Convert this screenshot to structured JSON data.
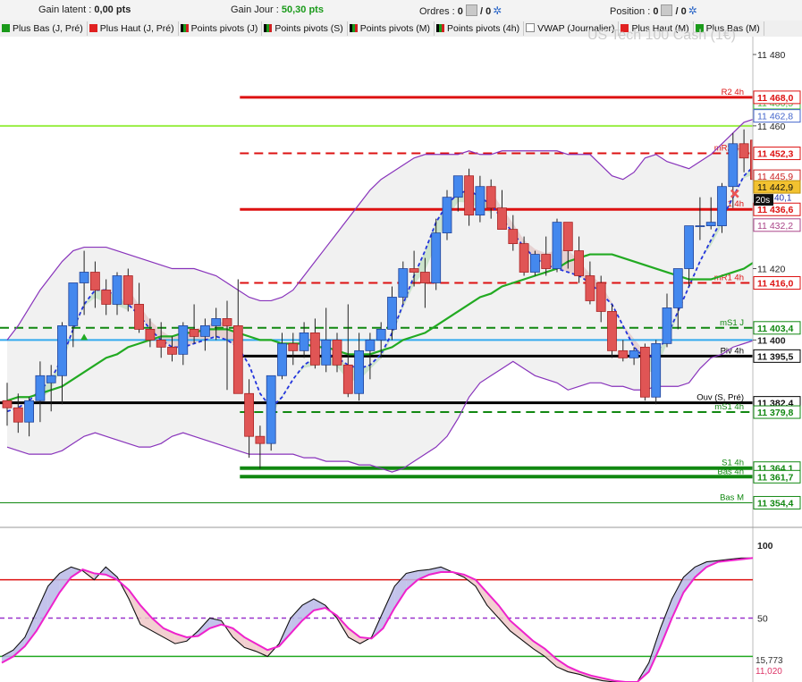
{
  "header": {
    "gain_latent_label": "Gain latent :",
    "gain_latent_value": "0,00 pts",
    "gain_jour_label": "Gain Jour :",
    "gain_jour_value": "50,30 pts",
    "ordres_label": "Ordres :",
    "ordres_count": "0",
    "ordres_sep": "/ 0",
    "position_label": "Position :",
    "position_count": "0",
    "position_sep": "/ 0"
  },
  "legend": [
    {
      "label": "Plus Bas (J, Pré)",
      "color": "#1a9a1a",
      "icon": "square-swatch"
    },
    {
      "label": "Plus Haut (J, Pré)",
      "color": "#e02020",
      "icon": "square-swatch"
    },
    {
      "label": "Points pivots (J)",
      "color": "#8b0000",
      "icon": "pivot-swatch"
    },
    {
      "label": "Points pivots (S)",
      "color": "#8b0000",
      "icon": "pivot-swatch"
    },
    {
      "label": "Points pivots (M)",
      "color": "#8b0000",
      "icon": "pivot-swatch"
    },
    {
      "label": "Points pivots (4h)",
      "color": "#8b0000",
      "icon": "pivot-swatch"
    },
    {
      "label": "VWAP (Journalier)",
      "color": "#ffffff",
      "icon": "empty-swatch"
    },
    {
      "label": "Plus Haut (M)",
      "color": "#e02020",
      "icon": "square-swatch"
    },
    {
      "label": "Plus Bas (M)",
      "color": "#1a9a1a",
      "icon": "square-swatch"
    }
  ],
  "chart_data": {
    "type": "candlestick",
    "watermark": "US Tech 100 Cash (1€)",
    "price_axis": {
      "ylim": [
        11348,
        11485
      ],
      "ticks": [
        "11 480",
        "11 460",
        "11 420",
        "11 400"
      ]
    },
    "candles": [
      {
        "o": 11383,
        "h": 11388,
        "l": 11376,
        "c": 11381
      },
      {
        "o": 11381,
        "h": 11385,
        "l": 11374,
        "c": 11377
      },
      {
        "o": 11377,
        "h": 11384,
        "l": 11373,
        "c": 11383
      },
      {
        "o": 11383,
        "h": 11394,
        "l": 11377,
        "c": 11390
      },
      {
        "o": 11388,
        "h": 11393,
        "l": 11380,
        "c": 11390
      },
      {
        "o": 11390,
        "h": 11405,
        "l": 11382,
        "c": 11404
      },
      {
        "o": 11404,
        "h": 11416,
        "l": 11398,
        "c": 11416
      },
      {
        "o": 11416,
        "h": 11425,
        "l": 11407,
        "c": 11419
      },
      {
        "o": 11419,
        "h": 11422,
        "l": 11409,
        "c": 11414
      },
      {
        "o": 11414,
        "h": 11417,
        "l": 11407,
        "c": 11410
      },
      {
        "o": 11410,
        "h": 11419,
        "l": 11407,
        "c": 11418
      },
      {
        "o": 11418,
        "h": 11420,
        "l": 11408,
        "c": 11410
      },
      {
        "o": 11410,
        "h": 11416,
        "l": 11402,
        "c": 11403
      },
      {
        "o": 11403,
        "h": 11406,
        "l": 11398,
        "c": 11400
      },
      {
        "o": 11400,
        "h": 11405,
        "l": 11395,
        "c": 11398
      },
      {
        "o": 11398,
        "h": 11401,
        "l": 11394,
        "c": 11396
      },
      {
        "o": 11396,
        "h": 11405,
        "l": 11393,
        "c": 11404
      },
      {
        "o": 11403,
        "h": 11410,
        "l": 11399,
        "c": 11401
      },
      {
        "o": 11401,
        "h": 11406,
        "l": 11397,
        "c": 11404
      },
      {
        "o": 11404,
        "h": 11409,
        "l": 11400,
        "c": 11406
      },
      {
        "o": 11406,
        "h": 11411,
        "l": 11386,
        "c": 11404
      },
      {
        "o": 11404,
        "h": 11417,
        "l": 11386,
        "c": 11385
      },
      {
        "o": 11385,
        "h": 11389,
        "l": 11367,
        "c": 11373
      },
      {
        "o": 11373,
        "h": 11376,
        "l": 11364,
        "c": 11371
      },
      {
        "o": 11371,
        "h": 11390,
        "l": 11369,
        "c": 11390
      },
      {
        "o": 11390,
        "h": 11402,
        "l": 11389,
        "c": 11399
      },
      {
        "o": 11399,
        "h": 11402,
        "l": 11393,
        "c": 11397
      },
      {
        "o": 11397,
        "h": 11405,
        "l": 11395,
        "c": 11402
      },
      {
        "o": 11402,
        "h": 11406,
        "l": 11392,
        "c": 11393
      },
      {
        "o": 11393,
        "h": 11409,
        "l": 11391,
        "c": 11400
      },
      {
        "o": 11400,
        "h": 11402,
        "l": 11391,
        "c": 11393
      },
      {
        "o": 11393,
        "h": 11410,
        "l": 11384,
        "c": 11385
      },
      {
        "o": 11385,
        "h": 11402,
        "l": 11383,
        "c": 11397
      },
      {
        "o": 11397,
        "h": 11402,
        "l": 11389,
        "c": 11400
      },
      {
        "o": 11400,
        "h": 11405,
        "l": 11395,
        "c": 11403
      },
      {
        "o": 11403,
        "h": 11415,
        "l": 11400,
        "c": 11412
      },
      {
        "o": 11412,
        "h": 11422,
        "l": 11410,
        "c": 11420
      },
      {
        "o": 11420,
        "h": 11425,
        "l": 11415,
        "c": 11419
      },
      {
        "o": 11419,
        "h": 11423,
        "l": 11409,
        "c": 11416
      },
      {
        "o": 11416,
        "h": 11434,
        "l": 11414,
        "c": 11430
      },
      {
        "o": 11430,
        "h": 11442,
        "l": 11428,
        "c": 11440
      },
      {
        "o": 11440,
        "h": 11446,
        "l": 11436,
        "c": 11446
      },
      {
        "o": 11446,
        "h": 11448,
        "l": 11432,
        "c": 11435
      },
      {
        "o": 11435,
        "h": 11446,
        "l": 11433,
        "c": 11443
      },
      {
        "o": 11443,
        "h": 11445,
        "l": 11434,
        "c": 11437
      },
      {
        "o": 11437,
        "h": 11442,
        "l": 11431,
        "c": 11431
      },
      {
        "o": 11431,
        "h": 11435,
        "l": 11425,
        "c": 11427
      },
      {
        "o": 11427,
        "h": 11429,
        "l": 11418,
        "c": 11419
      },
      {
        "o": 11419,
        "h": 11425,
        "l": 11418,
        "c": 11424
      },
      {
        "o": 11424,
        "h": 11429,
        "l": 11418,
        "c": 11420
      },
      {
        "o": 11420,
        "h": 11434,
        "l": 11419,
        "c": 11433
      },
      {
        "o": 11433,
        "h": 11433,
        "l": 11420,
        "c": 11425
      },
      {
        "o": 11425,
        "h": 11429,
        "l": 11416,
        "c": 11418
      },
      {
        "o": 11418,
        "h": 11422,
        "l": 11410,
        "c": 11411
      },
      {
        "o": 11416,
        "h": 11418,
        "l": 11405,
        "c": 11408
      },
      {
        "o": 11408,
        "h": 11410,
        "l": 11395,
        "c": 11397
      },
      {
        "o": 11397,
        "h": 11400,
        "l": 11394,
        "c": 11395
      },
      {
        "o": 11395,
        "h": 11398,
        "l": 11393,
        "c": 11397
      },
      {
        "o": 11398,
        "h": 11399,
        "l": 11383,
        "c": 11384
      },
      {
        "o": 11384,
        "h": 11400,
        "l": 11382,
        "c": 11399
      },
      {
        "o": 11399,
        "h": 11413,
        "l": 11398,
        "c": 11409
      },
      {
        "o": 11409,
        "h": 11420,
        "l": 11403,
        "c": 11420
      },
      {
        "o": 11420,
        "h": 11432,
        "l": 11415,
        "c": 11432
      },
      {
        "o": 11432,
        "h": 11440,
        "l": 11428,
        "c": 11432
      },
      {
        "o": 11432,
        "h": 11440,
        "l": 11431,
        "c": 11433
      },
      {
        "o": 11432,
        "h": 11444,
        "l": 11430,
        "c": 11443
      },
      {
        "o": 11443,
        "h": 11458,
        "l": 11437,
        "c": 11455
      },
      {
        "o": 11455,
        "h": 11459,
        "l": 11447,
        "c": 11451
      },
      {
        "o": 11456,
        "h": 11460,
        "l": 11444,
        "c": 11445
      }
    ],
    "series": [
      {
        "name": "MA",
        "color": "#22aa22",
        "values": [
          11383,
          11384,
          11384,
          11385,
          11386,
          11387,
          11389,
          11391,
          11393,
          11395,
          11396,
          11398,
          11399,
          11400,
          11401,
          11401,
          11402,
          11402,
          11403,
          11403,
          11403,
          11402,
          11401,
          11400,
          11400,
          11399,
          11399,
          11399,
          11398,
          11398,
          11397,
          11396,
          11396,
          11396,
          11397,
          11398,
          11400,
          11401,
          11402,
          11404,
          11406,
          11408,
          11410,
          11412,
          11413,
          11415,
          11416,
          11417,
          11418,
          11419,
          11420,
          11422,
          11423,
          11424,
          11424,
          11424,
          11423,
          11422,
          11421,
          11420,
          11419,
          11418,
          11417,
          11417,
          11417,
          11418,
          11419,
          11420,
          11422
        ]
      },
      {
        "name": "Moyenne pointillée",
        "color": "#2233dd",
        "values": [
          11380,
          11381,
          11383,
          11386,
          11389,
          11395,
          11403,
          11410,
          11414,
          11414,
          11412,
          11410,
          11407,
          11403,
          11400,
          11398,
          11398,
          11399,
          11400,
          11401,
          11400,
          11398,
          11393,
          11385,
          11381,
          11384,
          11389,
          11393,
          11395,
          11396,
          11395,
          11393,
          11392,
          11393,
          11396,
          11402,
          11410,
          11418,
          11425,
          11433,
          11438,
          11441,
          11442,
          11440,
          11438,
          11434,
          11430,
          11426,
          11423,
          11421,
          11420,
          11419,
          11418,
          11416,
          11413,
          11410,
          11404,
          11398,
          11395,
          11396,
          11401,
          11408,
          11415,
          11422,
          11428,
          11434,
          11440,
          11446,
          11449
        ]
      },
      {
        "name": "Bande supérieure",
        "color": "#8833bb",
        "values": [
          11400,
          11404,
          11409,
          11414,
          11418,
          11422,
          11425,
          11426,
          11426,
          11426,
          11425,
          11424,
          11423,
          11422,
          11421,
          11420,
          11420,
          11420,
          11419,
          11418,
          11416,
          11414,
          11412,
          11411,
          11411,
          11412,
          11414,
          11418,
          11422,
          11426,
          11430,
          11434,
          11438,
          11442,
          11445,
          11447,
          11449,
          11451,
          11452,
          11452,
          11452,
          11452,
          11453,
          11452,
          11452,
          11453,
          11453,
          11453,
          11453,
          11453,
          11453,
          11452,
          11452,
          11452,
          11449,
          11446,
          11445,
          11447,
          11451,
          11452,
          11450,
          11449,
          11448,
          11450,
          11452,
          11455,
          11458,
          11461,
          11462
        ]
      },
      {
        "name": "Bande inférieure",
        "color": "#8833bb",
        "values": [
          11370,
          11369,
          11368,
          11368,
          11368,
          11369,
          11371,
          11373,
          11374,
          11373,
          11372,
          11371,
          11370,
          11370,
          11371,
          11373,
          11374,
          11373,
          11372,
          11371,
          11370,
          11369,
          11368,
          11368,
          11368,
          11368,
          11368,
          11367,
          11367,
          11366,
          11366,
          11366,
          11365,
          11365,
          11364,
          11363,
          11364,
          11366,
          11368,
          11370,
          11373,
          11378,
          11384,
          11388,
          11390,
          11392,
          11394,
          11392,
          11390,
          11389,
          11388,
          11386,
          11387,
          11388,
          11388,
          11387,
          11387,
          11386,
          11386,
          11387,
          11387,
          11387,
          11388,
          11392,
          11395,
          11396,
          11398,
          11399,
          11400
        ]
      }
    ],
    "levels": [
      {
        "price": 11468.0,
        "label": "11 468,0",
        "name": "R2 4h",
        "color": "#dd1111",
        "style": "solid",
        "width": 3
      },
      {
        "price": 11452.3,
        "label": "11 452,3",
        "name": "mR2 4h",
        "color": "#dd1111",
        "style": "dashed",
        "width": 2
      },
      {
        "price": 11436.6,
        "label": "11 436,6",
        "name": "R1 4h",
        "color": "#dd1111",
        "style": "solid",
        "width": 3
      },
      {
        "price": 11416.0,
        "label": "11 416,0",
        "name": "mR1 4h",
        "color": "#dd1111",
        "style": "dashed",
        "width": 2
      },
      {
        "price": 11403.4,
        "label": "11 403,4",
        "name": "mS1 J",
        "color": "#118811",
        "style": "dashed",
        "width": 2
      },
      {
        "price": 11395.5,
        "label": "11 395,5",
        "name": "Piv 4h",
        "color": "#000000",
        "style": "solid",
        "width": 3
      },
      {
        "price": 11382.4,
        "label": "11 382,4",
        "name": "Ouv (S, Pré)",
        "color": "#000000",
        "style": "solid",
        "width": 3
      },
      {
        "price": 11379.8,
        "label": "11 379,8",
        "name": "mS1 4h",
        "color": "#118811",
        "style": "dashed",
        "width": 2
      },
      {
        "price": 11364.1,
        "label": "11 364,1",
        "name": "S1 4h",
        "color": "#118811",
        "style": "solid",
        "width": 4
      },
      {
        "price": 11361.7,
        "label": "11 361,7",
        "name": "Bas 4h",
        "color": "#118811",
        "style": "solid",
        "width": 4
      },
      {
        "price": 11354.4,
        "label": "11 354,4",
        "name": "Bas M",
        "color": "#118811",
        "style": "solid",
        "width": 1
      }
    ],
    "extra_lines": [
      {
        "price": 11460.0,
        "color": "#99ee44",
        "name": "Plus Haut (J, Pré)"
      },
      {
        "price": 11400.0,
        "color": "#33aaee",
        "name": "VWAP"
      }
    ],
    "price_tags": [
      {
        "price": 11466.5,
        "label": "11 466,5",
        "color": "#44bb44"
      },
      {
        "price": 11462.8,
        "label": "11 462,8",
        "color": "#4466cc"
      },
      {
        "price": 11445.9,
        "label": "11 445,9",
        "color": "#cc2222"
      },
      {
        "price": 11440.1,
        "label": "40,1",
        "color": "#2233aa"
      },
      {
        "price": 11432.2,
        "label": "11 432,2",
        "color": "#aa4488"
      }
    ],
    "current_price": {
      "price": 11442.9,
      "label": "11 442,9",
      "timer": "20s"
    },
    "oscillator": {
      "ylim": [
        0,
        100
      ],
      "levels": [
        80,
        50,
        20
      ],
      "tick_labels": [
        "100",
        "50"
      ],
      "k_values": [
        20,
        25,
        35,
        55,
        75,
        85,
        90,
        87,
        80,
        90,
        82,
        65,
        45,
        40,
        35,
        30,
        32,
        40,
        50,
        48,
        35,
        27,
        24,
        20,
        30,
        50,
        60,
        65,
        60,
        50,
        35,
        30,
        35,
        55,
        75,
        85,
        87,
        88,
        90,
        86,
        82,
        75,
        60,
        50,
        40,
        33,
        26,
        20,
        12,
        8,
        6,
        3,
        1,
        0,
        0,
        0,
        15,
        42,
        65,
        82,
        90,
        94,
        95,
        96,
        97,
        97
      ],
      "d_values": [
        15,
        20,
        28,
        40,
        55,
        70,
        82,
        88,
        85,
        84,
        80,
        72,
        60,
        50,
        42,
        38,
        35,
        36,
        42,
        45,
        42,
        35,
        30,
        25,
        28,
        38,
        48,
        56,
        58,
        52,
        42,
        35,
        34,
        42,
        58,
        72,
        80,
        84,
        86,
        86,
        84,
        80,
        70,
        60,
        48,
        40,
        32,
        26,
        18,
        12,
        8,
        5,
        3,
        1,
        0,
        0,
        8,
        28,
        50,
        70,
        82,
        90,
        94,
        95,
        96,
        97
      ],
      "readout": [
        {
          "label": "15,773",
          "color": "#333333"
        },
        {
          "label": "11,020",
          "color": "#dd3366"
        }
      ]
    }
  }
}
